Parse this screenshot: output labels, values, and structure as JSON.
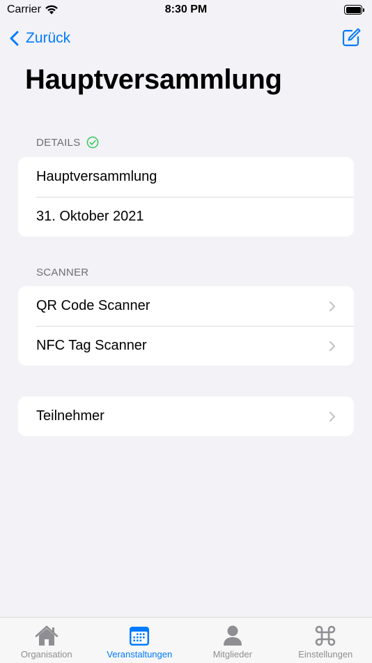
{
  "status_bar": {
    "carrier": "Carrier",
    "time": "8:30 PM"
  },
  "nav": {
    "back_label": "Zurück",
    "edit_icon": "compose-icon"
  },
  "page": {
    "title": "Hauptversammlung"
  },
  "details": {
    "header": "DETAILS",
    "rows": [
      "Hauptversammlung",
      "31. Oktober 2021"
    ]
  },
  "scanner": {
    "header": "SCANNER",
    "rows": [
      "QR Code Scanner",
      "NFC Tag Scanner"
    ]
  },
  "participants": {
    "label": "Teilnehmer"
  },
  "tabs": [
    {
      "label": "Organisation",
      "icon": "house-icon"
    },
    {
      "label": "Veranstaltungen",
      "icon": "calendar-icon"
    },
    {
      "label": "Mitglieder",
      "icon": "person-icon"
    },
    {
      "label": "Einstellungen",
      "icon": "command-icon"
    }
  ],
  "colors": {
    "accent": "#007aff",
    "success": "#34c759",
    "inactive": "#8e8e93",
    "background": "#f2f2f7"
  }
}
